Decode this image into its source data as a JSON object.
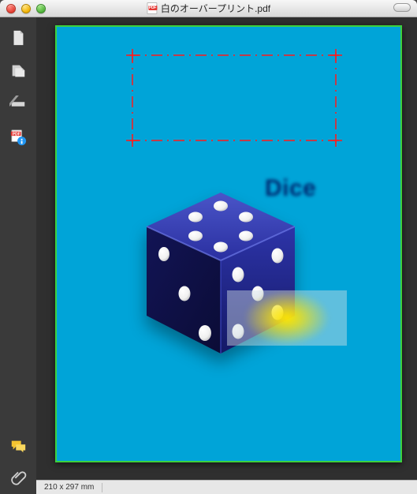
{
  "window": {
    "title": "白のオーバープリント.pdf"
  },
  "sidebar": {
    "tools": [
      {
        "name": "document-tool"
      },
      {
        "name": "copy-page-tool"
      },
      {
        "name": "edit-slash-tool"
      },
      {
        "name": "pdf-info-tool"
      }
    ],
    "bottom": [
      {
        "name": "comments-tool"
      },
      {
        "name": "attachments-tool"
      }
    ]
  },
  "page": {
    "background": "#00a4d8",
    "label": "Dice",
    "selection_box_color": "#ff1a1a"
  },
  "statusbar": {
    "dimensions": "210 x 297 mm"
  }
}
